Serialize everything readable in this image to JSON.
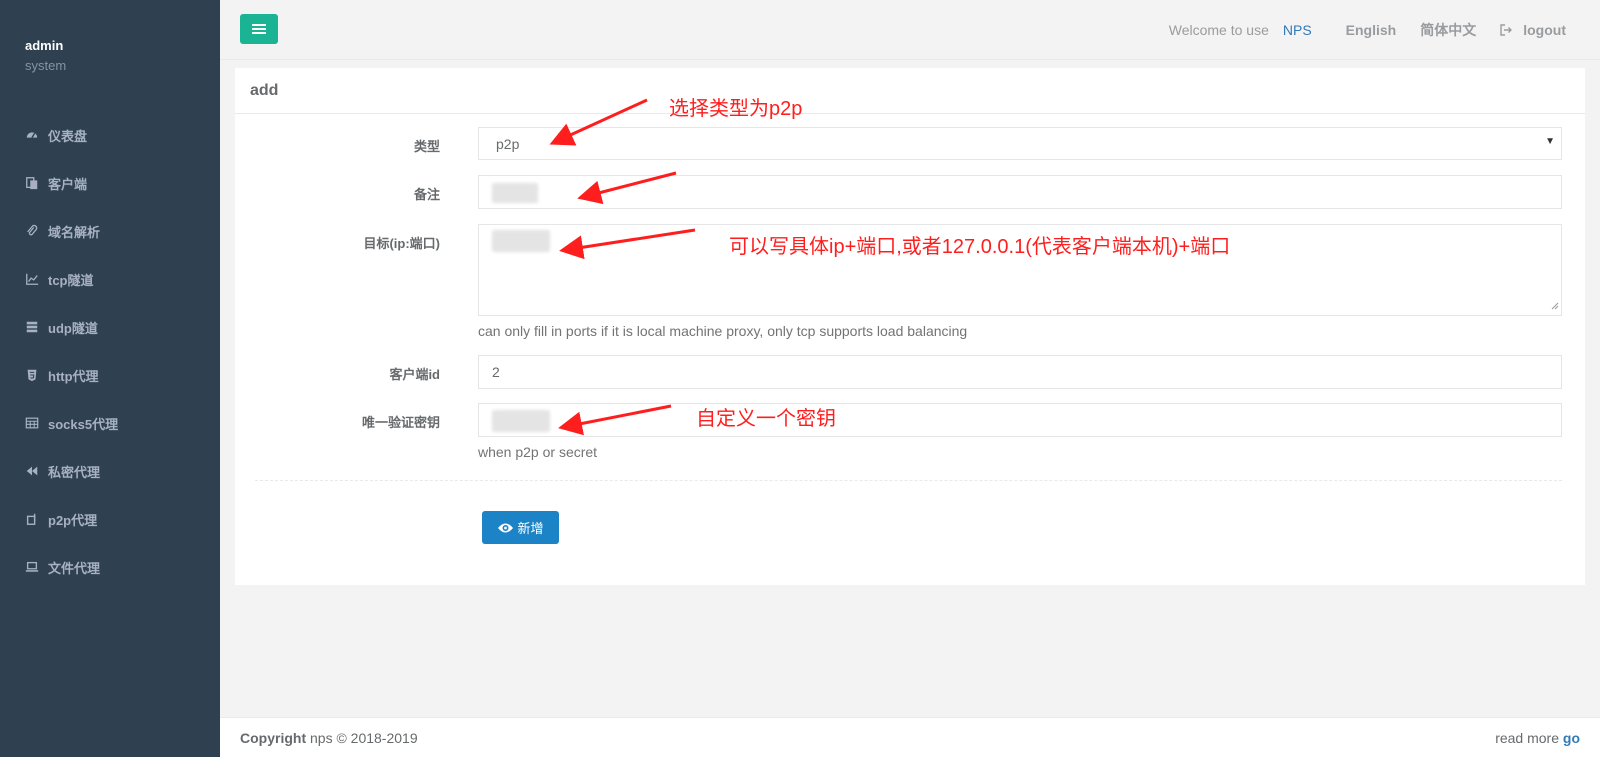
{
  "sidebar": {
    "user": "admin",
    "role": "system",
    "items": [
      {
        "label": "仪表盘",
        "icon": "dashboard-icon"
      },
      {
        "label": "客户端",
        "icon": "clients-icon"
      },
      {
        "label": "域名解析",
        "icon": "paperclip-icon"
      },
      {
        "label": "tcp隧道",
        "icon": "line-chart-icon"
      },
      {
        "label": "udp隧道",
        "icon": "server-icon"
      },
      {
        "label": "http代理",
        "icon": "html5-icon"
      },
      {
        "label": "socks5代理",
        "icon": "table-icon"
      },
      {
        "label": "私密代理",
        "icon": "backward-icon"
      },
      {
        "label": "p2p代理",
        "icon": "p2p-icon"
      },
      {
        "label": "文件代理",
        "icon": "laptop-icon"
      }
    ]
  },
  "header": {
    "welcome": "Welcome to use",
    "nps": "NPS",
    "lang_en": "English",
    "lang_zh": "简体中文",
    "logout": "logout"
  },
  "panel": {
    "title": "add",
    "fields": {
      "type": {
        "label": "类型",
        "value": "p2p"
      },
      "remark": {
        "label": "备注"
      },
      "target": {
        "label": "目标(ip:端口)",
        "help": "can only fill in ports if it is local machine proxy, only tcp supports load balancing"
      },
      "client_id": {
        "label": "客户端id",
        "value": "2"
      },
      "secret": {
        "label": "唯一验证密钥",
        "help": "when p2p or secret"
      }
    },
    "submit_label": "新增"
  },
  "annotations": {
    "type_note": "选择类型为p2p",
    "target_note": "可以写具体ip+端口,或者127.0.0.1(代表客户端本机)+端口",
    "secret_note": "自定义一个密钥"
  },
  "footer": {
    "copyright_label": "Copyright",
    "copyright_text": "nps © 2018-2019",
    "read_more": "read more",
    "go": "go"
  },
  "colors": {
    "sidebar_bg": "#2f4050",
    "accent_green": "#1ab394",
    "button_blue": "#1c84c6",
    "link_blue": "#337ab7",
    "annotation_red": "#ff1e1e"
  }
}
